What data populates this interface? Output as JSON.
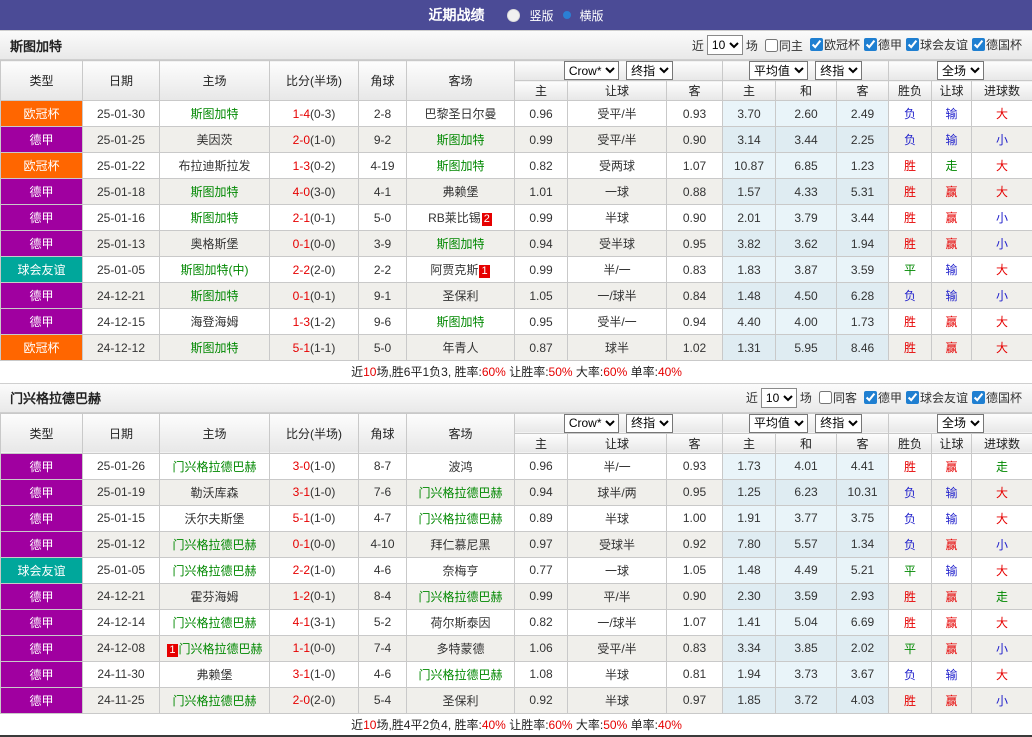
{
  "topbar": {
    "title": "近期战绩",
    "vertical_label": "竖版",
    "horizontal_label": "横版"
  },
  "filter_labels": {
    "near": "近",
    "count": "10",
    "unit": "场"
  },
  "header": {
    "type": "类型",
    "date": "日期",
    "home": "主场",
    "score": "比分(半场)",
    "corner": "角球",
    "away": "客场",
    "dd_crow": "Crow*",
    "dd_final": "终指",
    "dd_avg": "平均值",
    "dd_full": "全场",
    "sub_home": "主",
    "sub_handicap": "让球",
    "sub_away": "客",
    "sub_avg_home": "主",
    "sub_draw": "和",
    "sub_avg_away": "客",
    "sub_result": "胜负",
    "sub_handicap2": "让球",
    "sub_goals": "进球数"
  },
  "league_colors": {
    "欧冠杯": "#ff6600",
    "德甲": "#a000a0",
    "球会友谊": "#00a79b"
  },
  "result_colors": {
    "r": "#e60000",
    "b": "#2222cc",
    "g": "#008800"
  },
  "sections": [
    {
      "team": "斯图加特",
      "same_label": "同主",
      "leagues": [
        "欧冠杯",
        "德甲",
        "球会友谊",
        "德国杯"
      ],
      "rows": [
        {
          "league": "欧冠杯",
          "date": "25-01-30",
          "home": "斯图加特",
          "home_green": true,
          "home_badge": "",
          "home_badge_pos": "",
          "score": "1-4",
          "half": "(0-3)",
          "corner": "2-8",
          "away": "巴黎圣日尔曼",
          "away_green": false,
          "away_badge": "",
          "away_badge_pos": "",
          "odds": [
            "0.96",
            "受平/半",
            "0.93"
          ],
          "avg": [
            "3.70",
            "2.60",
            "2.49"
          ],
          "results": [
            [
              "负",
              "b"
            ],
            [
              "输",
              "b"
            ],
            [
              "大",
              "r"
            ]
          ]
        },
        {
          "league": "德甲",
          "date": "25-01-25",
          "home": "美因茨",
          "home_green": false,
          "home_badge": "",
          "home_badge_pos": "",
          "score": "2-0",
          "half": "(1-0)",
          "corner": "9-2",
          "away": "斯图加特",
          "away_green": true,
          "away_badge": "",
          "away_badge_pos": "",
          "odds": [
            "0.99",
            "受平/半",
            "0.90"
          ],
          "avg": [
            "3.14",
            "3.44",
            "2.25"
          ],
          "results": [
            [
              "负",
              "b"
            ],
            [
              "输",
              "b"
            ],
            [
              "小",
              "b"
            ]
          ]
        },
        {
          "league": "欧冠杯",
          "date": "25-01-22",
          "home": "布拉迪斯拉发",
          "home_green": false,
          "home_badge": "",
          "home_badge_pos": "",
          "score": "1-3",
          "half": "(0-2)",
          "corner": "4-19",
          "away": "斯图加特",
          "away_green": true,
          "away_badge": "",
          "away_badge_pos": "",
          "odds": [
            "0.82",
            "受两球",
            "1.07"
          ],
          "avg": [
            "10.87",
            "6.85",
            "1.23"
          ],
          "results": [
            [
              "胜",
              "r"
            ],
            [
              "走",
              "g"
            ],
            [
              "大",
              "r"
            ]
          ]
        },
        {
          "league": "德甲",
          "date": "25-01-18",
          "home": "斯图加特",
          "home_green": true,
          "home_badge": "",
          "home_badge_pos": "",
          "score": "4-0",
          "half": "(3-0)",
          "corner": "4-1",
          "away": "弗赖堡",
          "away_green": false,
          "away_badge": "",
          "away_badge_pos": "",
          "odds": [
            "1.01",
            "一球",
            "0.88"
          ],
          "avg": [
            "1.57",
            "4.33",
            "5.31"
          ],
          "results": [
            [
              "胜",
              "r"
            ],
            [
              "赢",
              "r"
            ],
            [
              "大",
              "r"
            ]
          ]
        },
        {
          "league": "德甲",
          "date": "25-01-16",
          "home": "斯图加特",
          "home_green": true,
          "home_badge": "",
          "home_badge_pos": "",
          "score": "2-1",
          "half": "(0-1)",
          "corner": "5-0",
          "away": "RB莱比锡",
          "away_green": false,
          "away_badge": "2",
          "away_badge_pos": "after",
          "odds": [
            "0.99",
            "半球",
            "0.90"
          ],
          "avg": [
            "2.01",
            "3.79",
            "3.44"
          ],
          "results": [
            [
              "胜",
              "r"
            ],
            [
              "赢",
              "r"
            ],
            [
              "小",
              "b"
            ]
          ]
        },
        {
          "league": "德甲",
          "date": "25-01-13",
          "home": "奥格斯堡",
          "home_green": false,
          "home_badge": "",
          "home_badge_pos": "",
          "score": "0-1",
          "half": "(0-0)",
          "corner": "3-9",
          "away": "斯图加特",
          "away_green": true,
          "away_badge": "",
          "away_badge_pos": "",
          "odds": [
            "0.94",
            "受半球",
            "0.95"
          ],
          "avg": [
            "3.82",
            "3.62",
            "1.94"
          ],
          "results": [
            [
              "胜",
              "r"
            ],
            [
              "赢",
              "r"
            ],
            [
              "小",
              "b"
            ]
          ]
        },
        {
          "league": "球会友谊",
          "date": "25-01-05",
          "home": "斯图加特(中)",
          "home_green": true,
          "home_badge": "",
          "home_badge_pos": "",
          "score": "2-2",
          "half": "(2-0)",
          "corner": "2-2",
          "away": "阿贾克斯",
          "away_green": false,
          "away_badge": "1",
          "away_badge_pos": "after",
          "odds": [
            "0.99",
            "半/一",
            "0.83"
          ],
          "avg": [
            "1.83",
            "3.87",
            "3.59"
          ],
          "results": [
            [
              "平",
              "g"
            ],
            [
              "输",
              "b"
            ],
            [
              "大",
              "r"
            ]
          ]
        },
        {
          "league": "德甲",
          "date": "24-12-21",
          "home": "斯图加特",
          "home_green": true,
          "home_badge": "",
          "home_badge_pos": "",
          "score": "0-1",
          "half": "(0-1)",
          "corner": "9-1",
          "away": "圣保利",
          "away_green": false,
          "away_badge": "",
          "away_badge_pos": "",
          "odds": [
            "1.05",
            "一/球半",
            "0.84"
          ],
          "avg": [
            "1.48",
            "4.50",
            "6.28"
          ],
          "results": [
            [
              "负",
              "b"
            ],
            [
              "输",
              "b"
            ],
            [
              "小",
              "b"
            ]
          ]
        },
        {
          "league": "德甲",
          "date": "24-12-15",
          "home": "海登海姆",
          "home_green": false,
          "home_badge": "",
          "home_badge_pos": "",
          "score": "1-3",
          "half": "(1-2)",
          "corner": "9-6",
          "away": "斯图加特",
          "away_green": true,
          "away_badge": "",
          "away_badge_pos": "",
          "odds": [
            "0.95",
            "受半/一",
            "0.94"
          ],
          "avg": [
            "4.40",
            "4.00",
            "1.73"
          ],
          "results": [
            [
              "胜",
              "r"
            ],
            [
              "赢",
              "r"
            ],
            [
              "大",
              "r"
            ]
          ]
        },
        {
          "league": "欧冠杯",
          "date": "24-12-12",
          "home": "斯图加特",
          "home_green": true,
          "home_badge": "",
          "home_badge_pos": "",
          "score": "5-1",
          "half": "(1-1)",
          "corner": "5-0",
          "away": "年青人",
          "away_green": false,
          "away_badge": "",
          "away_badge_pos": "",
          "odds": [
            "0.87",
            "球半",
            "1.02"
          ],
          "avg": [
            "1.31",
            "5.95",
            "8.46"
          ],
          "results": [
            [
              "胜",
              "r"
            ],
            [
              "赢",
              "r"
            ],
            [
              "大",
              "r"
            ]
          ]
        }
      ],
      "summary": [
        [
          "近",
          "k"
        ],
        [
          "10",
          "r"
        ],
        [
          "场,胜6平1负3, 胜率:",
          "k"
        ],
        [
          "60%",
          "r"
        ],
        [
          " 让胜率:",
          "k"
        ],
        [
          "50%",
          "r"
        ],
        [
          " 大率:",
          "k"
        ],
        [
          "60%",
          "r"
        ],
        [
          " 单率:",
          "k"
        ],
        [
          "40%",
          "r"
        ]
      ]
    },
    {
      "team": "门兴格拉德巴赫",
      "same_label": "同客",
      "leagues": [
        "德甲",
        "球会友谊",
        "德国杯"
      ],
      "rows": [
        {
          "league": "德甲",
          "date": "25-01-26",
          "home": "门兴格拉德巴赫",
          "home_green": true,
          "home_badge": "",
          "home_badge_pos": "",
          "score": "3-0",
          "half": "(1-0)",
          "corner": "8-7",
          "away": "波鸿",
          "away_green": false,
          "away_badge": "",
          "away_badge_pos": "",
          "odds": [
            "0.96",
            "半/一",
            "0.93"
          ],
          "avg": [
            "1.73",
            "4.01",
            "4.41"
          ],
          "results": [
            [
              "胜",
              "r"
            ],
            [
              "赢",
              "r"
            ],
            [
              "走",
              "g"
            ]
          ]
        },
        {
          "league": "德甲",
          "date": "25-01-19",
          "home": "勒沃库森",
          "home_green": false,
          "home_badge": "",
          "home_badge_pos": "",
          "score": "3-1",
          "half": "(1-0)",
          "corner": "7-6",
          "away": "门兴格拉德巴赫",
          "away_green": true,
          "away_badge": "",
          "away_badge_pos": "",
          "odds": [
            "0.94",
            "球半/两",
            "0.95"
          ],
          "avg": [
            "1.25",
            "6.23",
            "10.31"
          ],
          "results": [
            [
              "负",
              "b"
            ],
            [
              "输",
              "b"
            ],
            [
              "大",
              "r"
            ]
          ]
        },
        {
          "league": "德甲",
          "date": "25-01-15",
          "home": "沃尔夫斯堡",
          "home_green": false,
          "home_badge": "",
          "home_badge_pos": "",
          "score": "5-1",
          "half": "(1-0)",
          "corner": "4-7",
          "away": "门兴格拉德巴赫",
          "away_green": true,
          "away_badge": "",
          "away_badge_pos": "",
          "odds": [
            "0.89",
            "半球",
            "1.00"
          ],
          "avg": [
            "1.91",
            "3.77",
            "3.75"
          ],
          "results": [
            [
              "负",
              "b"
            ],
            [
              "输",
              "b"
            ],
            [
              "大",
              "r"
            ]
          ]
        },
        {
          "league": "德甲",
          "date": "25-01-12",
          "home": "门兴格拉德巴赫",
          "home_green": true,
          "home_badge": "",
          "home_badge_pos": "",
          "score": "0-1",
          "half": "(0-0)",
          "corner": "4-10",
          "away": "拜仁慕尼黑",
          "away_green": false,
          "away_badge": "",
          "away_badge_pos": "",
          "odds": [
            "0.97",
            "受球半",
            "0.92"
          ],
          "avg": [
            "7.80",
            "5.57",
            "1.34"
          ],
          "results": [
            [
              "负",
              "b"
            ],
            [
              "赢",
              "r"
            ],
            [
              "小",
              "b"
            ]
          ]
        },
        {
          "league": "球会友谊",
          "date": "25-01-05",
          "home": "门兴格拉德巴赫",
          "home_green": true,
          "home_badge": "",
          "home_badge_pos": "",
          "score": "2-2",
          "half": "(1-0)",
          "corner": "4-6",
          "away": "奈梅亨",
          "away_green": false,
          "away_badge": "",
          "away_badge_pos": "",
          "odds": [
            "0.77",
            "一球",
            "1.05"
          ],
          "avg": [
            "1.48",
            "4.49",
            "5.21"
          ],
          "results": [
            [
              "平",
              "g"
            ],
            [
              "输",
              "b"
            ],
            [
              "大",
              "r"
            ]
          ]
        },
        {
          "league": "德甲",
          "date": "24-12-21",
          "home": "霍芬海姆",
          "home_green": false,
          "home_badge": "",
          "home_badge_pos": "",
          "score": "1-2",
          "half": "(0-1)",
          "corner": "8-4",
          "away": "门兴格拉德巴赫",
          "away_green": true,
          "away_badge": "",
          "away_badge_pos": "",
          "odds": [
            "0.99",
            "平/半",
            "0.90"
          ],
          "avg": [
            "2.30",
            "3.59",
            "2.93"
          ],
          "results": [
            [
              "胜",
              "r"
            ],
            [
              "赢",
              "r"
            ],
            [
              "走",
              "g"
            ]
          ]
        },
        {
          "league": "德甲",
          "date": "24-12-14",
          "home": "门兴格拉德巴赫",
          "home_green": true,
          "home_badge": "",
          "home_badge_pos": "",
          "score": "4-1",
          "half": "(3-1)",
          "corner": "5-2",
          "away": "荷尔斯泰因",
          "away_green": false,
          "away_badge": "",
          "away_badge_pos": "",
          "odds": [
            "0.82",
            "一/球半",
            "1.07"
          ],
          "avg": [
            "1.41",
            "5.04",
            "6.69"
          ],
          "results": [
            [
              "胜",
              "r"
            ],
            [
              "赢",
              "r"
            ],
            [
              "大",
              "r"
            ]
          ]
        },
        {
          "league": "德甲",
          "date": "24-12-08",
          "home": "门兴格拉德巴赫",
          "home_green": true,
          "home_badge": "1",
          "home_badge_pos": "before",
          "score": "1-1",
          "half": "(0-0)",
          "corner": "7-4",
          "away": "多特蒙德",
          "away_green": false,
          "away_badge": "",
          "away_badge_pos": "",
          "odds": [
            "1.06",
            "受平/半",
            "0.83"
          ],
          "avg": [
            "3.34",
            "3.85",
            "2.02"
          ],
          "results": [
            [
              "平",
              "g"
            ],
            [
              "赢",
              "r"
            ],
            [
              "小",
              "b"
            ]
          ]
        },
        {
          "league": "德甲",
          "date": "24-11-30",
          "home": "弗赖堡",
          "home_green": false,
          "home_badge": "",
          "home_badge_pos": "",
          "score": "3-1",
          "half": "(1-0)",
          "corner": "4-6",
          "away": "门兴格拉德巴赫",
          "away_green": true,
          "away_badge": "",
          "away_badge_pos": "",
          "odds": [
            "1.08",
            "半球",
            "0.81"
          ],
          "avg": [
            "1.94",
            "3.73",
            "3.67"
          ],
          "results": [
            [
              "负",
              "b"
            ],
            [
              "输",
              "b"
            ],
            [
              "大",
              "r"
            ]
          ]
        },
        {
          "league": "德甲",
          "date": "24-11-25",
          "home": "门兴格拉德巴赫",
          "home_green": true,
          "home_badge": "",
          "home_badge_pos": "",
          "score": "2-0",
          "half": "(2-0)",
          "corner": "5-4",
          "away": "圣保利",
          "away_green": false,
          "away_badge": "",
          "away_badge_pos": "",
          "odds": [
            "0.92",
            "半球",
            "0.97"
          ],
          "avg": [
            "1.85",
            "3.72",
            "4.03"
          ],
          "results": [
            [
              "胜",
              "r"
            ],
            [
              "赢",
              "r"
            ],
            [
              "小",
              "b"
            ]
          ]
        }
      ],
      "summary": [
        [
          "近",
          "k"
        ],
        [
          "10",
          "r"
        ],
        [
          "场,胜4平2负4, 胜率:",
          "k"
        ],
        [
          "40%",
          "r"
        ],
        [
          " 让胜率:",
          "k"
        ],
        [
          "60%",
          "r"
        ],
        [
          " 大率:",
          "k"
        ],
        [
          "50%",
          "r"
        ],
        [
          " 单率:",
          "k"
        ],
        [
          "40%",
          "r"
        ]
      ]
    }
  ]
}
